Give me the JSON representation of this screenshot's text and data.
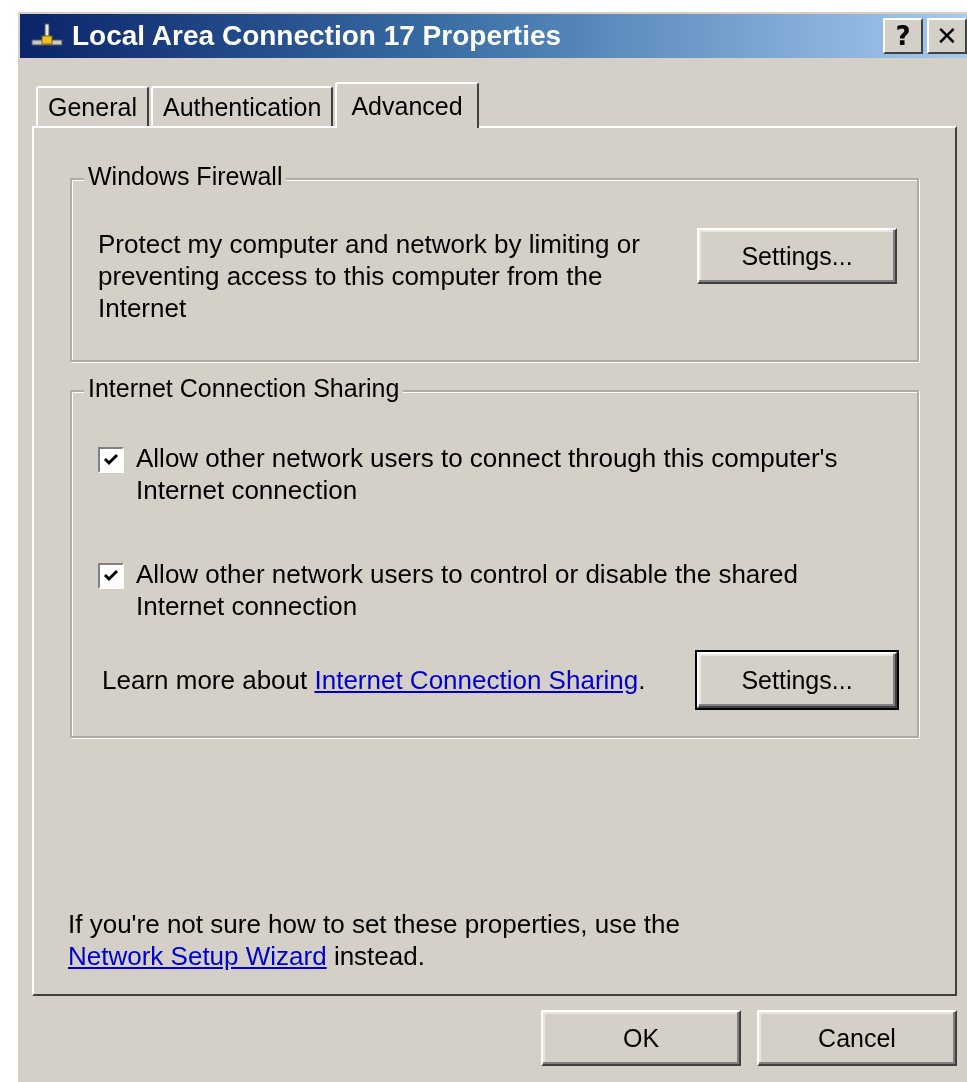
{
  "window": {
    "title": "Local Area Connection 17 Properties",
    "help_button": "?",
    "close_button": "✕"
  },
  "tabs": [
    {
      "label": "General",
      "selected": false
    },
    {
      "label": "Authentication",
      "selected": false
    },
    {
      "label": "Advanced",
      "selected": true
    }
  ],
  "firewall": {
    "title": "Windows Firewall",
    "description": "Protect my computer and network by limiting or preventing access to this computer from the Internet",
    "button": "Settings..."
  },
  "sharing": {
    "title": "Internet Connection Sharing",
    "options": [
      {
        "label": "Allow other network users to connect through this computer's Internet connection",
        "checked": true
      },
      {
        "label": "Allow other network users to control or disable the shared Internet connection",
        "checked": true
      }
    ],
    "learn_more": {
      "before": "Learn more about ",
      "link": "Internet Connection Sharing",
      "after": "."
    },
    "button": "Settings..."
  },
  "note": {
    "before": "If you're not sure how to set these properties, use the ",
    "link": "Network Setup Wizard",
    "after": " instead."
  },
  "buttons": [
    "OK",
    "Cancel"
  ]
}
